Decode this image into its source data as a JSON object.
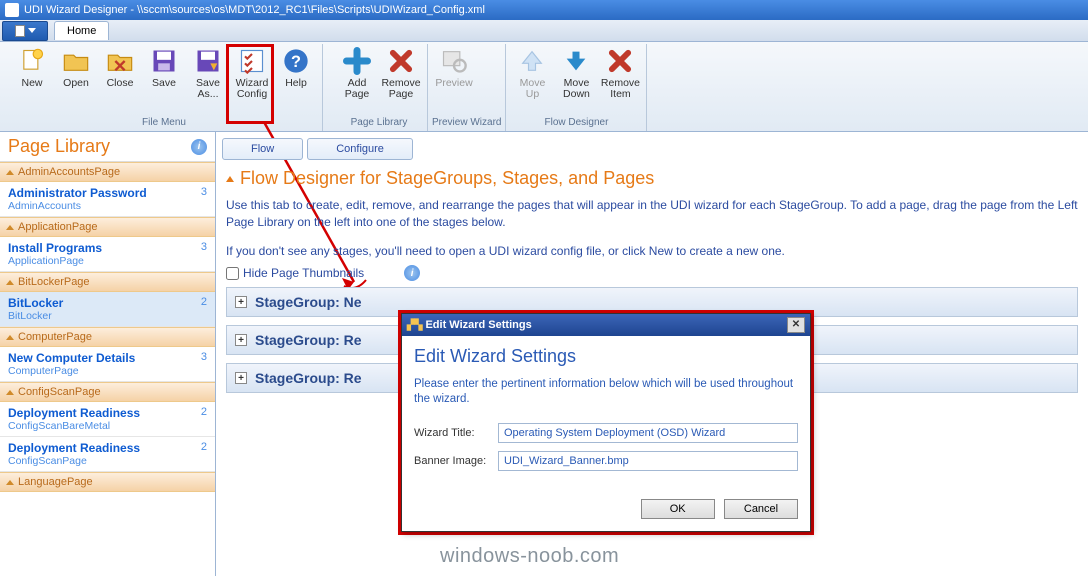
{
  "title": "UDI Wizard Designer - \\\\sccm\\sources\\os\\MDT\\2012_RC1\\Files\\Scripts\\UDIWizard_Config.xml",
  "tabs": {
    "home": "Home"
  },
  "ribbon": {
    "file_menu": "File Menu",
    "page_library": "Page Library",
    "preview_wizard": "Preview Wizard",
    "flow_designer": "Flow Designer",
    "new": "New",
    "open": "Open",
    "close": "Close",
    "save": "Save",
    "save_as": "Save\nAs...",
    "wizard_config": "Wizard\nConfig",
    "help": "Help",
    "add_page": "Add\nPage",
    "remove_page": "Remove\nPage",
    "preview": "Preview",
    "move_up": "Move\nUp",
    "move_down": "Move\nDown",
    "remove_item": "Remove\nItem"
  },
  "sidebar": {
    "title": "Page Library",
    "groups": [
      {
        "name": "AdminAccountsPage",
        "items": [
          {
            "title": "Administrator Password",
            "sub": "AdminAccounts",
            "count": 3
          }
        ]
      },
      {
        "name": "ApplicationPage",
        "items": [
          {
            "title": "Install Programs",
            "sub": "ApplicationPage",
            "count": 3
          }
        ]
      },
      {
        "name": "BitLockerPage",
        "items": [
          {
            "title": "BitLocker",
            "sub": "BitLocker",
            "count": 2,
            "selected": true
          }
        ]
      },
      {
        "name": "ComputerPage",
        "items": [
          {
            "title": "New Computer Details",
            "sub": "ComputerPage",
            "count": 3
          }
        ]
      },
      {
        "name": "ConfigScanPage",
        "items": [
          {
            "title": "Deployment Readiness",
            "sub": "ConfigScanBareMetal",
            "count": 2
          },
          {
            "title": "Deployment Readiness",
            "sub": "ConfigScanPage",
            "count": 2
          }
        ]
      },
      {
        "name": "LanguagePage",
        "items": []
      }
    ]
  },
  "subtabs": {
    "flow": "Flow",
    "configure": "Configure"
  },
  "main": {
    "heading": "Flow Designer for StageGroups, Stages, and Pages",
    "p1": "Use this tab to create, edit, remove, and rearrange the pages that will appear in the UDI wizard for each StageGroup. To add a page, drag the page from the Left Page Library on the left into one of the stages below.",
    "p2": "If you don't see any stages, you'll need to open a UDI wizard config file, or click New to create a new one.",
    "hide_thumbs": "Hide Page Thumbnails",
    "stage_groups": [
      "StageGroup: Ne",
      "StageGroup: Re",
      "StageGroup: Re"
    ]
  },
  "dialog": {
    "titlebar": "Edit Wizard Settings",
    "heading": "Edit Wizard Settings",
    "text": "Please enter the pertinent information below which will be used throughout the wizard.",
    "title_label": "Wizard Title:",
    "title_value": "Operating System Deployment (OSD) Wizard",
    "banner_label": "Banner Image:",
    "banner_value": "UDI_Wizard_Banner.bmp",
    "ok": "OK",
    "cancel": "Cancel"
  },
  "watermark": "windows-noob.com"
}
